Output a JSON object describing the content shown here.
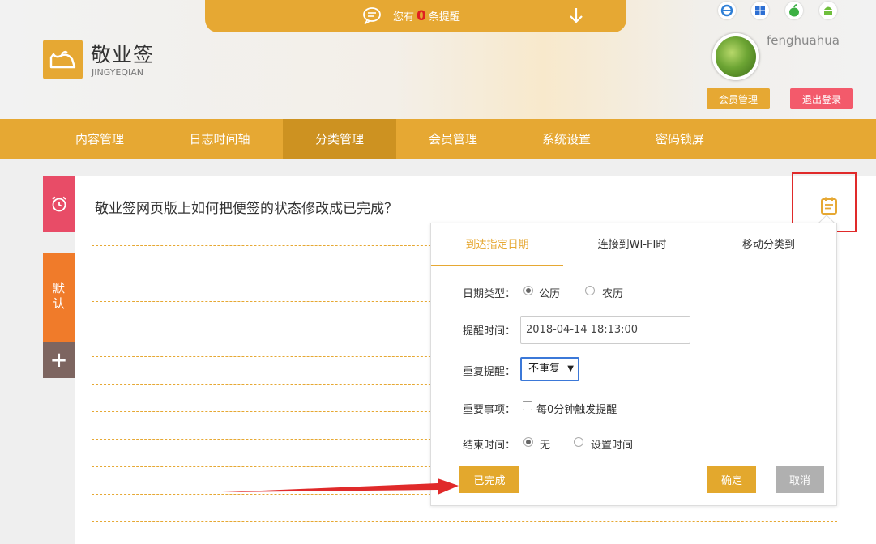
{
  "header": {
    "notice_prefix": "您有",
    "notice_count": "0",
    "notice_suffix": "条提醒",
    "logo_title": "敬业签",
    "logo_subtitle": "JINGYEQIAN",
    "os_icons": [
      "ie-icon",
      "windows-icon",
      "apple-icon",
      "android-icon"
    ],
    "username": "fenghuahua",
    "member_button": "会员管理",
    "logout_button": "退出登录"
  },
  "nav": {
    "items": [
      {
        "label": "内容管理",
        "active": false
      },
      {
        "label": "日志时间轴",
        "active": false
      },
      {
        "label": "分类管理",
        "active": true
      },
      {
        "label": "会员管理",
        "active": false
      },
      {
        "label": "系统设置",
        "active": false
      },
      {
        "label": "密码锁屏",
        "active": false
      }
    ]
  },
  "sidebar": {
    "default_label": "默认",
    "add_label": "+"
  },
  "note": {
    "title": "敬业签网页版上如何把便签的状态修改成已完成？"
  },
  "popup": {
    "tabs": [
      {
        "label": "到达指定日期",
        "active": true
      },
      {
        "label": "连接到WI-FI时",
        "active": false
      },
      {
        "label": "移动分类到",
        "active": false
      }
    ],
    "date_type_label": "日期类型：",
    "date_type_options": [
      "公历",
      "农历"
    ],
    "date_type_selected": "公历",
    "remind_time_label": "提醒时间：",
    "remind_time_value": "2018-04-14 18:13:00",
    "repeat_label": "重复提醒：",
    "repeat_value": "不重复",
    "important_label": "重要事项：",
    "important_checkbox_label": "每0分钟触发提醒",
    "end_time_label": "结束时间：",
    "end_time_options": [
      "无",
      "设置时间"
    ],
    "end_time_selected": "无",
    "done_button": "已完成",
    "ok_button": "确定",
    "cancel_button": "取消"
  },
  "colors": {
    "accent": "#e6a833",
    "nav_active": "#cd9221",
    "alarm_tab": "#e84c67",
    "default_tab": "#f07b2a",
    "add_tab": "#7d6560",
    "logout": "#f35a6b",
    "annotation_red": "#e02a2a"
  }
}
